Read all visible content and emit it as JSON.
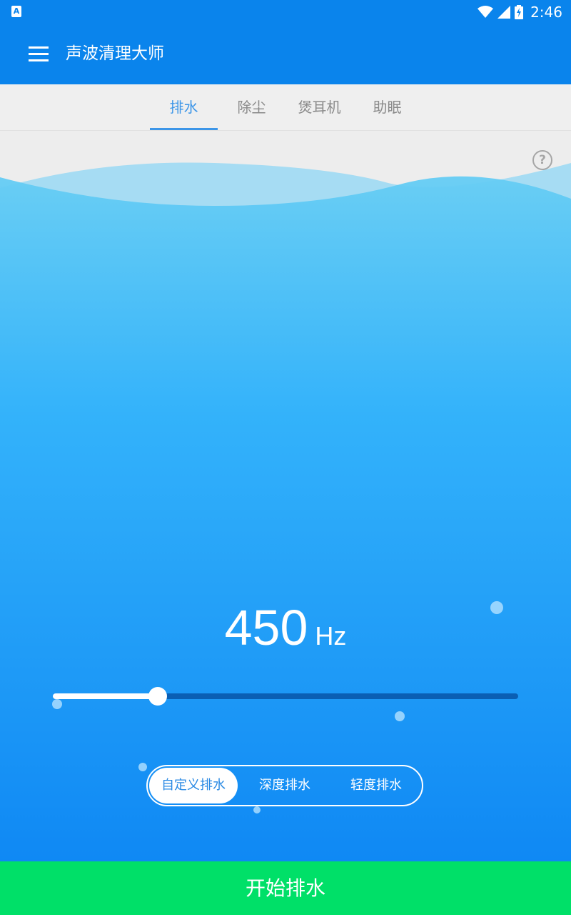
{
  "status_bar": {
    "app_icon_letter": "A",
    "time": "2:46",
    "icons": [
      "wifi-icon",
      "signal-icon",
      "battery-charging-icon"
    ]
  },
  "toolbar": {
    "title": "声波清理大师",
    "menu_icon": "menu-icon"
  },
  "tabs": [
    {
      "label": "排水",
      "active": true
    },
    {
      "label": "除尘",
      "active": false
    },
    {
      "label": "煲耳机",
      "active": false
    },
    {
      "label": "助眠",
      "active": false
    }
  ],
  "main": {
    "help_icon_glyph": "?",
    "frequency": {
      "value": "450",
      "unit": "Hz"
    },
    "slider": {
      "level_fraction": 0.225
    },
    "modes": [
      {
        "label": "自定义排水",
        "selected": true
      },
      {
        "label": "深度排水",
        "selected": false
      },
      {
        "label": "轻度排水",
        "selected": false
      }
    ]
  },
  "action_button": {
    "label": "开始排水"
  },
  "colors": {
    "primary": "#0a84ec",
    "active_tab": "#3d96e8",
    "start_button": "#00e068"
  }
}
